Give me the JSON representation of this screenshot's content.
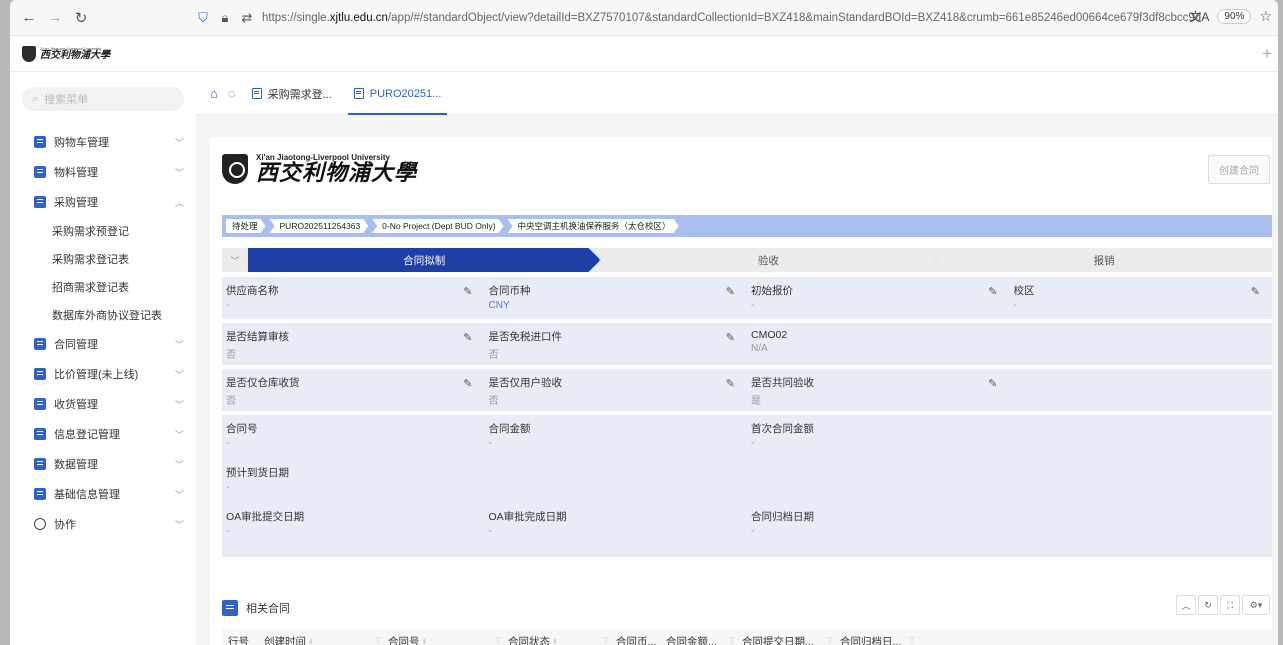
{
  "browser": {
    "url_prefix": "https://single.",
    "url_domain": "xjtlu.edu.cn",
    "url_rest": "/app/#/standardObject/view?detailId=BXZ7570107&standardCollectionId=BXZ418&mainStandardBOId=BXZ418&crumb=661e85246ed00664ce679f3df8cbcc9d",
    "zoom": "90%",
    "icons": [
      "back-icon",
      "forward-icon",
      "reload-icon",
      "shield-icon",
      "lock-icon",
      "settings-icon",
      "translate-icon",
      "star-icon"
    ]
  },
  "header": {
    "logo_en": "Xi'an Jiaotong-Liverpool University",
    "logo_cn": "西交利物浦大學"
  },
  "sidebar": {
    "search_placeholder": "搜索菜单",
    "items": [
      {
        "label": "购物车管理"
      },
      {
        "label": "物料管理"
      },
      {
        "label": "采购管理"
      },
      {
        "label": "合同管理"
      },
      {
        "label": "比价管理(未上线)"
      },
      {
        "label": "收货管理"
      },
      {
        "label": "信息登记管理"
      },
      {
        "label": "数据管理"
      },
      {
        "label": "基础信息管理"
      },
      {
        "label": "协作"
      }
    ],
    "sub_items": [
      "采购需求预登记",
      "采购需求登记表",
      "招商需求登记表",
      "数据库外商协议登记表"
    ]
  },
  "tabs": [
    {
      "label": "采购需求登..."
    },
    {
      "label": "PURO20251..."
    }
  ],
  "card": {
    "logo_en": "Xi'an Jiaotong-Liverpool University",
    "logo_cn": "西交利物浦大學",
    "create_button": "创建合同",
    "breadcrumbs": [
      "待处理",
      "PURO202511254363",
      "0-No Project (Dept BUD Only)",
      "中央空调主机换油保养服务（太仓校区）"
    ],
    "steps": [
      "合同拟制",
      "验收",
      "报销"
    ],
    "row1": [
      {
        "label": "供应商名称",
        "value": "-"
      },
      {
        "label": "合同币种",
        "value": "CNY"
      },
      {
        "label": "初始报价",
        "value": "-"
      },
      {
        "label": "校区",
        "value": "-"
      }
    ],
    "row2": [
      {
        "label": "是否结算审核",
        "value": "否"
      },
      {
        "label": "是否免税进口件",
        "value": "否"
      },
      {
        "label": "CMO02",
        "value": "N/A"
      }
    ],
    "row3": [
      {
        "label": "是否仅仓库收货",
        "value": "否"
      },
      {
        "label": "是否仅用户验收",
        "value": "否"
      },
      {
        "label": "是否共同验收",
        "value": "是"
      }
    ],
    "group": {
      "line1": [
        {
          "label": "合同号",
          "value": "-"
        },
        {
          "label": "合同金额",
          "value": "-"
        },
        {
          "label": "首次合同金额",
          "value": "-"
        }
      ],
      "line2": [
        {
          "label": "预计到货日期",
          "value": "-"
        }
      ],
      "line3": [
        {
          "label": "OA审批提交日期",
          "value": "-"
        },
        {
          "label": "OA审批完成日期",
          "value": "-"
        },
        {
          "label": "合同归档日期",
          "value": "-"
        }
      ]
    },
    "related": {
      "title": "相关合同",
      "columns": [
        "行号",
        "创建时间",
        "合同号",
        "合同状态",
        "合同币...",
        "合同金额...",
        "合同提交日期...",
        "合同归档日..."
      ]
    }
  }
}
